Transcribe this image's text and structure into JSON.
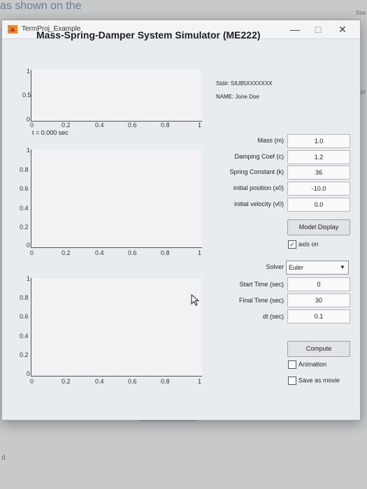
{
  "background": {
    "fragment_top": "as shown on the",
    "right_edge_1": "Star",
    "right_edge_2": "pr",
    "bottom_left": "d"
  },
  "window": {
    "title": "TermProj_Example",
    "minimize": "—",
    "maximize": "□",
    "close": "✕"
  },
  "app_title": "Mass-Spring-Damper System Simulator (ME222)",
  "plot1": {
    "y_ticks": [
      "1",
      "0.5",
      "0"
    ],
    "x_ticks": [
      "0",
      "0.2",
      "0.4",
      "0.6",
      "0.8",
      "1"
    ],
    "time_label": "t = 0.000 sec"
  },
  "plot2": {
    "y_ticks": [
      "1",
      "0.8",
      "0.6",
      "0.4",
      "0.2",
      "0"
    ],
    "x_ticks": [
      "0",
      "0.2",
      "0.4",
      "0.6",
      "0.8",
      "1"
    ]
  },
  "plot3": {
    "y_ticks": [
      "1",
      "0.8",
      "0.6",
      "0.4",
      "0.2",
      "0"
    ],
    "x_ticks": [
      "0",
      "0.2",
      "0.4",
      "0.6",
      "0.8",
      "1"
    ]
  },
  "student": {
    "std_label": "Std#: SIU85XXXXXXX",
    "name_label": "NAME: Jone Doe"
  },
  "params": {
    "mass_label": "Mass (m)",
    "mass_value": "1.0",
    "damping_label": "Damping Coef (c)",
    "damping_value": "1.2",
    "spring_label": "Spring Constant (k)",
    "spring_value": "36",
    "x0_label": "initial position (x0)",
    "x0_value": "-10.0",
    "v0_label": "initial velocity (v0)",
    "v0_value": "0.0"
  },
  "model_display_label": "Model Display",
  "axis_on_label": "axis on",
  "axis_on_checked": true,
  "solver": {
    "label": "Solver",
    "value": "Euler"
  },
  "time": {
    "start_label": "Start Time (sec)",
    "start_value": "0",
    "final_label": "Final Time (sec)",
    "final_value": "30",
    "dt_label": "dt (sec)",
    "dt_value": "0.1"
  },
  "compute_label": "Compute",
  "animation_label": "Animation",
  "save_movie_label": "Save as movie",
  "colors": {
    "window_bg": "#e9ecef",
    "plot_bg": "#f2f2f4",
    "field_bg": "#fafafa"
  }
}
